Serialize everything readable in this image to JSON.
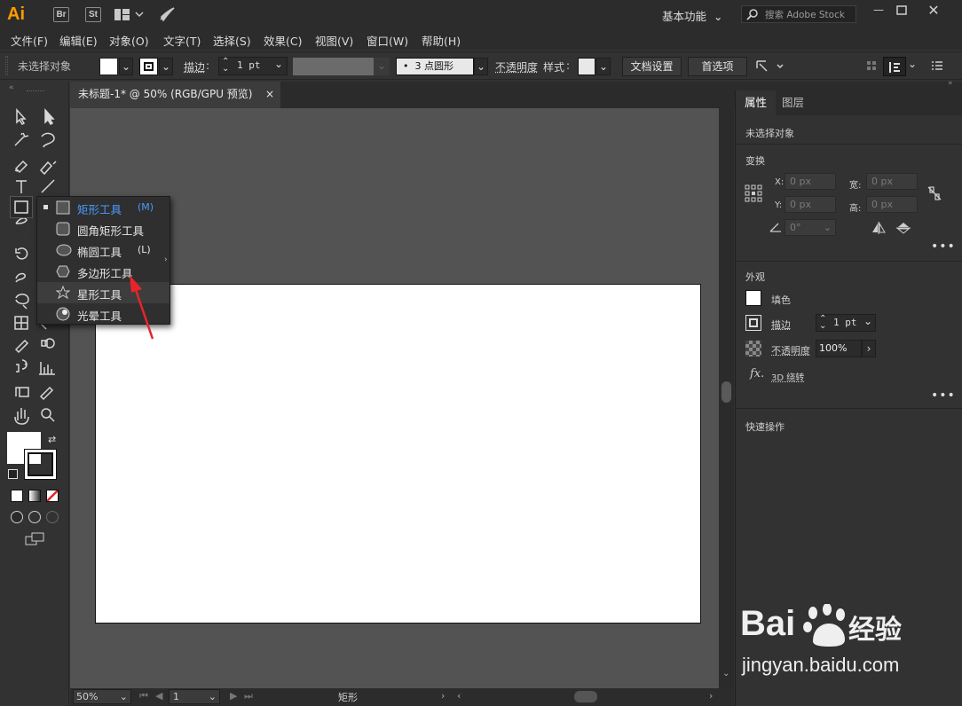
{
  "app": {
    "logo": "Ai",
    "bridge": "Br",
    "stock": "St"
  },
  "title_bar": {
    "workspace": "基本功能",
    "search_placeholder": "搜索 Adobe Stock"
  },
  "menu": [
    "文件(F)",
    "编辑(E)",
    "对象(O)",
    "文字(T)",
    "选择(S)",
    "效果(C)",
    "视图(V)",
    "窗口(W)",
    "帮助(H)"
  ],
  "control_bar": {
    "selection": "未选择对象",
    "stroke_label": "描边",
    "stroke_value": "1 pt",
    "brush": "3 点圆形",
    "opacity_label": "不透明度",
    "style_label": "样式",
    "doc_setup": "文档设置",
    "prefs": "首选项"
  },
  "document": {
    "tab_title": "未标题-1* @ 50% (RGB/GPU 预览)",
    "close": "×"
  },
  "flyout": {
    "items": [
      {
        "label": "矩形工具",
        "shortcut": "(M)",
        "icon": "rectangle-icon",
        "active": true
      },
      {
        "label": "圆角矩形工具",
        "shortcut": "",
        "icon": "rounded-rectangle-icon",
        "active": false
      },
      {
        "label": "椭圆工具",
        "shortcut": "(L)",
        "icon": "ellipse-icon",
        "active": false
      },
      {
        "label": "多边形工具",
        "shortcut": "",
        "icon": "polygon-icon",
        "active": false
      },
      {
        "label": "星形工具",
        "shortcut": "",
        "icon": "star-icon",
        "active": false
      },
      {
        "label": "光晕工具",
        "shortcut": "",
        "icon": "flare-icon",
        "active": false
      }
    ]
  },
  "status_bar": {
    "zoom": "50%",
    "page": "1",
    "tool": "矩形"
  },
  "properties_panel": {
    "tabs": [
      "属性",
      "图层"
    ],
    "no_selection": "未选择对象",
    "transform_title": "变换",
    "x_label": "X:",
    "x_value": "0 px",
    "y_label": "Y:",
    "y_value": "0 px",
    "w_label": "宽:",
    "w_value": "0 px",
    "h_label": "高:",
    "h_value": "0 px",
    "angle_value": "0°",
    "appearance_title": "外观",
    "fill_label": "填色",
    "stroke_label": "描边",
    "stroke_value": "1 pt",
    "opacity_label": "不透明度",
    "opacity_value": "100%",
    "fx_label": "fx.",
    "rotate3d_label": "3D 绕转",
    "quick_actions_title": "快速操作"
  },
  "watermark": {
    "brand": "Bai",
    "brand2": "经验",
    "url": "jingyan.baidu.com"
  },
  "colors": {
    "accent": "#4a9bff",
    "arrow": "#e8242a",
    "logo": "#ff9a00"
  }
}
